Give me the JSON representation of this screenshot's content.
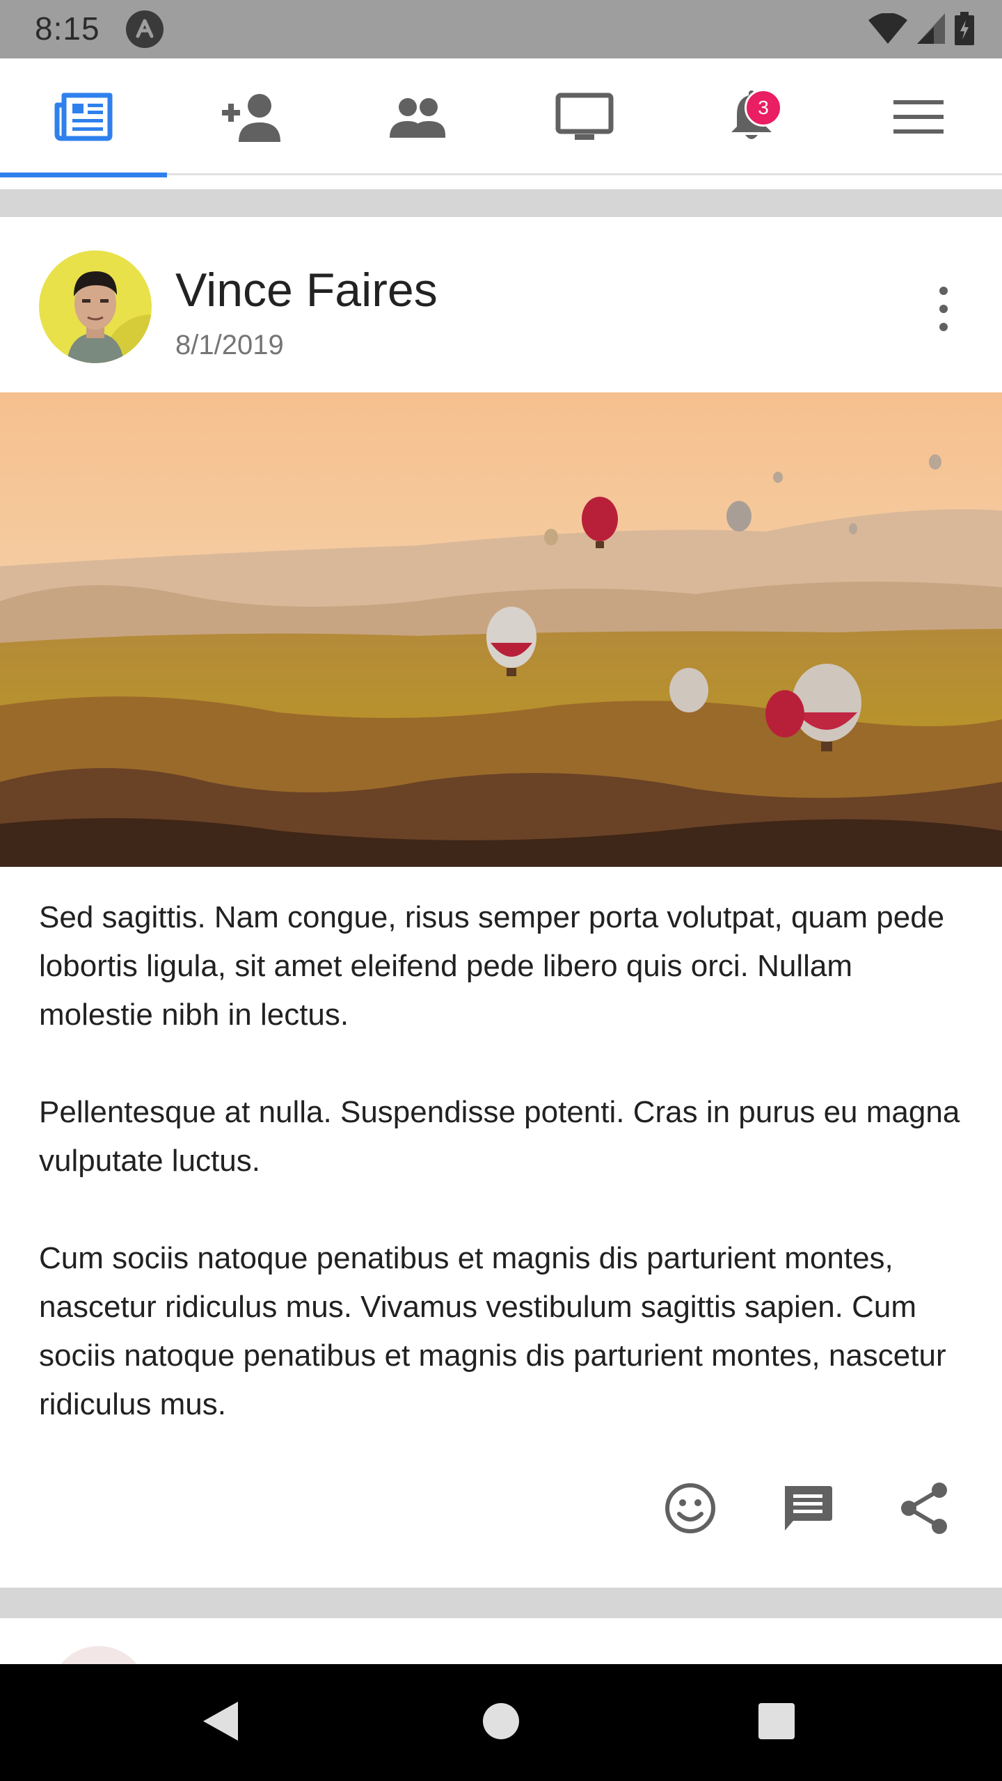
{
  "status_bar": {
    "time": "8:15",
    "icons": [
      "app-notification-icon",
      "wifi-icon",
      "cell-signal-icon",
      "battery-icon"
    ]
  },
  "tabs": [
    {
      "name": "news-feed",
      "icon": "newspaper-icon",
      "active": true
    },
    {
      "name": "add-friend",
      "icon": "person-add-icon",
      "active": false
    },
    {
      "name": "groups",
      "icon": "people-icon",
      "active": false
    },
    {
      "name": "watch",
      "icon": "monitor-icon",
      "active": false
    },
    {
      "name": "notifications",
      "icon": "bell-icon",
      "active": false,
      "badge": "3"
    },
    {
      "name": "menu",
      "icon": "hamburger-icon",
      "active": false
    }
  ],
  "colors": {
    "accent": "#2f80ed",
    "badge": "#e91e63",
    "status_bar": "#9e9e9e",
    "separator": "#d6d6d6",
    "icon_gray": "#616161"
  },
  "post": {
    "author": "Vince Faires",
    "date": "8/1/2019",
    "image": "hot-air-balloons-landscape",
    "paragraphs": [
      "Sed sagittis. Nam congue, risus semper porta volutpat, quam pede lobortis ligula, sit amet eleifend pede libero quis orci. Nullam molestie nibh in lectus.",
      "Pellentesque at nulla. Suspendisse potenti. Cras in purus eu magna vulputate luctus.",
      "Cum sociis natoque penatibus et magnis dis parturient montes, nascetur ridiculus mus. Vivamus vestibulum sagittis sapien. Cum sociis natoque penatibus et magnis dis parturient montes, nascetur ridiculus mus."
    ],
    "actions": [
      "emoji-icon",
      "comment-icon",
      "share-icon"
    ]
  },
  "nav_bar": {
    "buttons": [
      "back-icon",
      "home-icon",
      "recents-icon"
    ]
  }
}
